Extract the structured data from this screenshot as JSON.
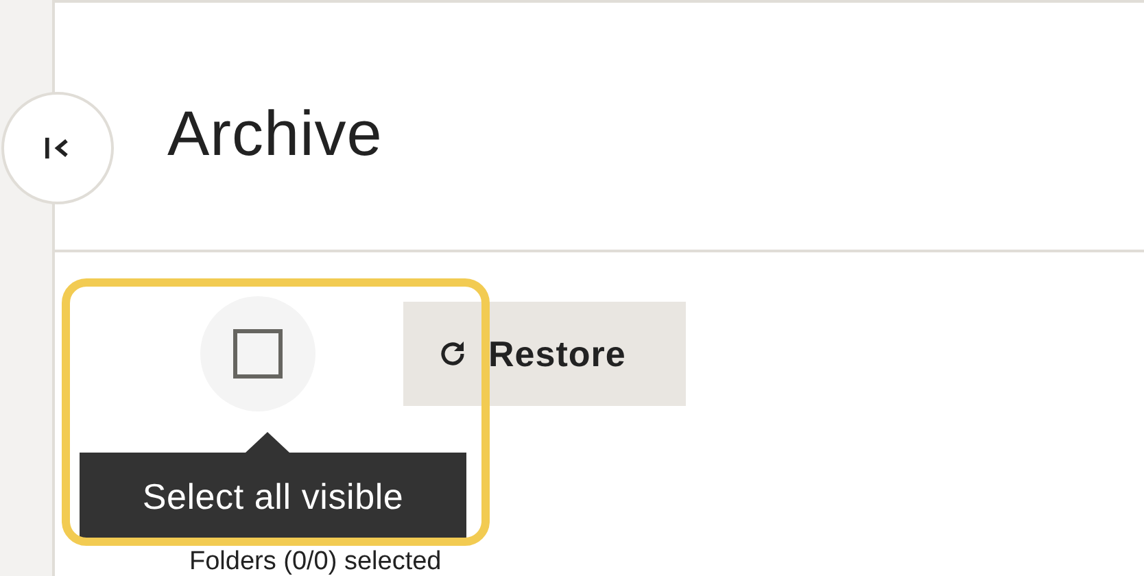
{
  "title": "Archive",
  "select_all": {
    "checked": false,
    "highlighted": true,
    "tooltip": "Select all visible"
  },
  "restore_button": {
    "label": "Restore"
  },
  "selection_summary": "Folders (0/0) selected"
}
